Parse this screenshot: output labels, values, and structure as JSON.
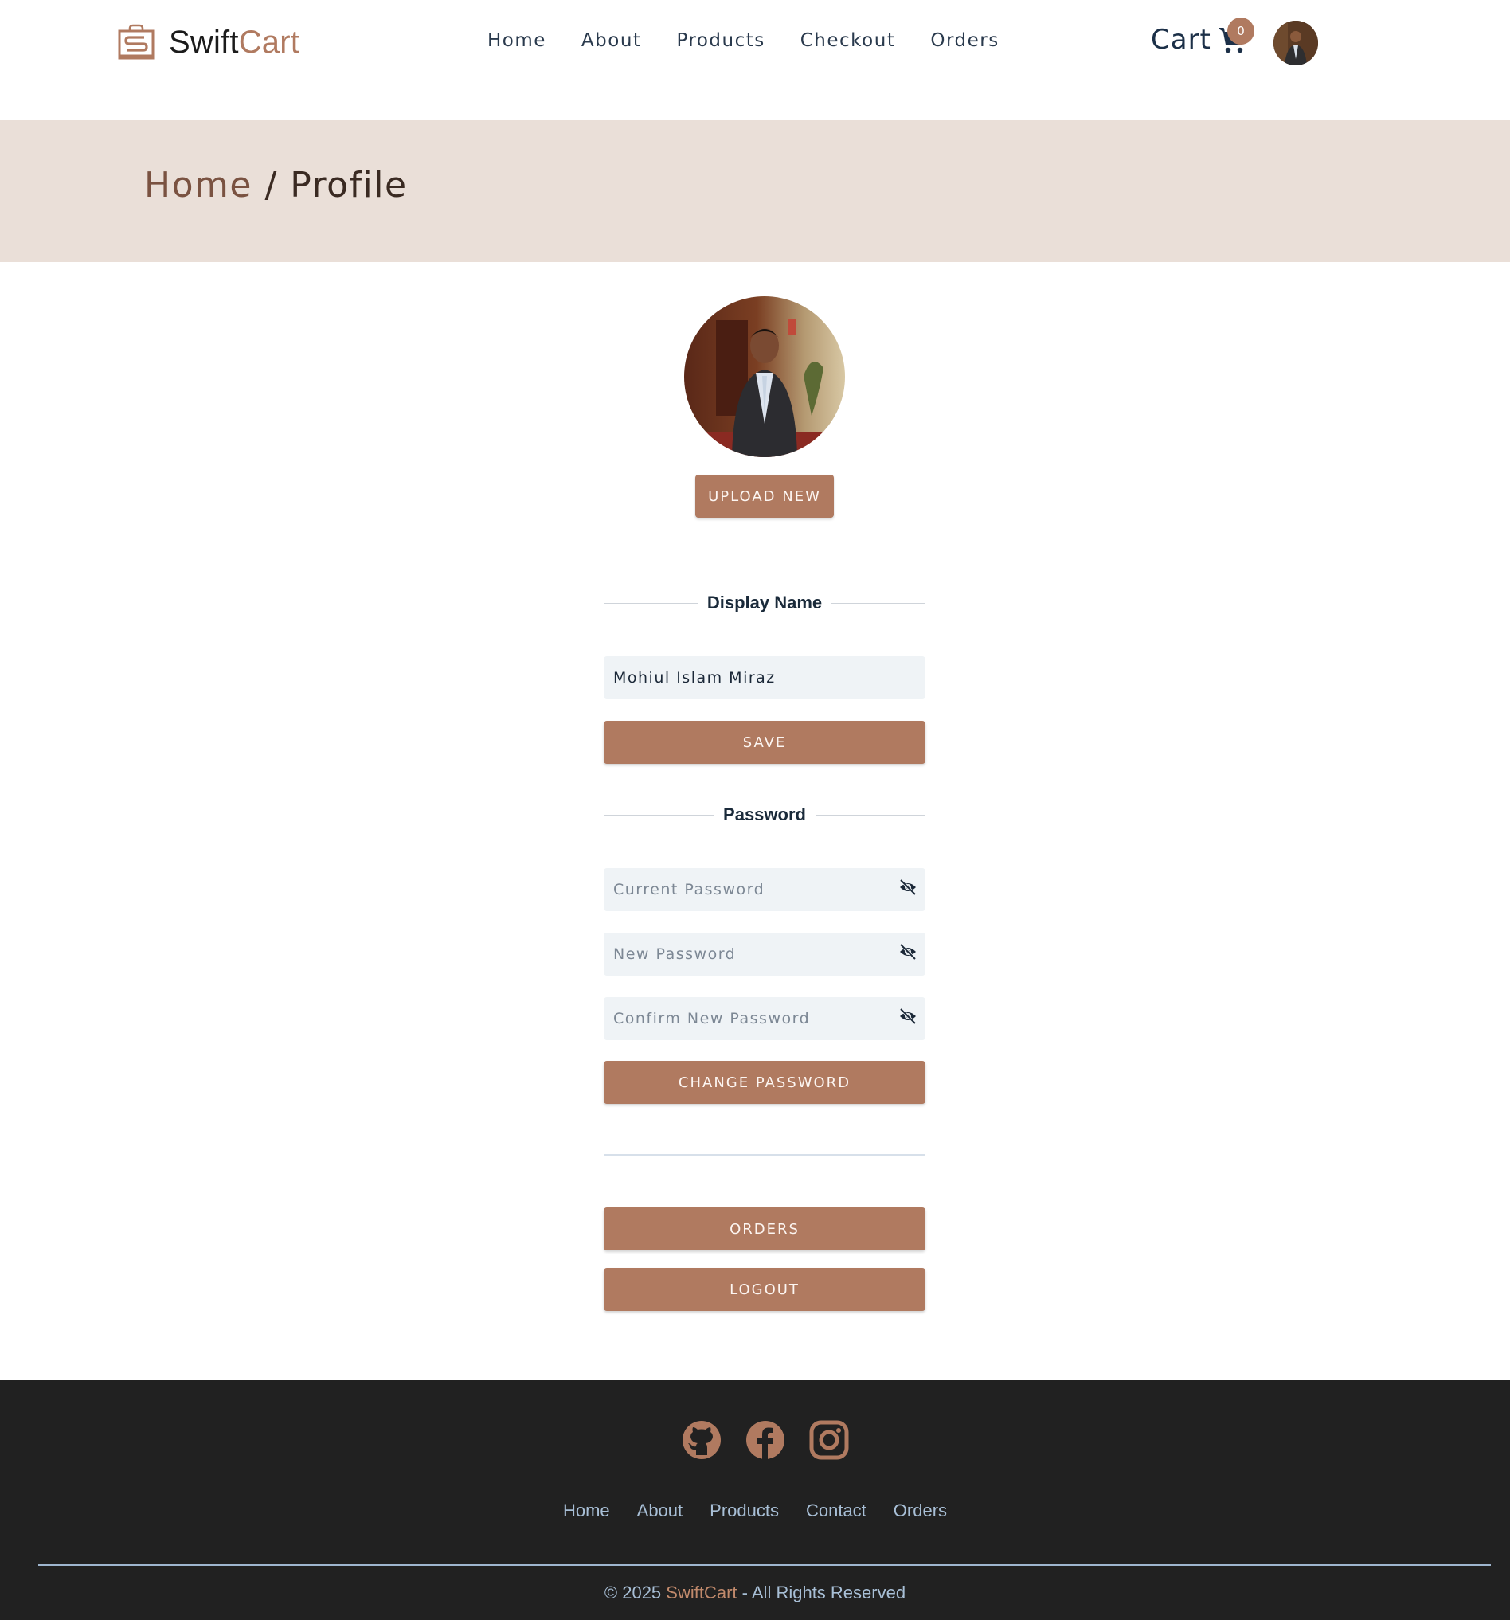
{
  "brand": {
    "name_part1": "Swift",
    "name_part2": "Cart",
    "icon": "shopping-bag-icon"
  },
  "nav": {
    "items": [
      "Home",
      "About",
      "Products",
      "Checkout",
      "Orders"
    ]
  },
  "cart": {
    "label": "Cart",
    "count": "0",
    "icon": "shopping-cart-icon"
  },
  "breadcrumb": {
    "home": "Home",
    "separator": "/",
    "current": "Profile"
  },
  "profile": {
    "upload_label": "UPLOAD NEW",
    "display_name_title": "Display Name",
    "display_name_value": "Mohiul Islam Miraz",
    "save_label": "SAVE",
    "password_title": "Password",
    "current_password_placeholder": "Current Password",
    "new_password_placeholder": "New Password",
    "confirm_password_placeholder": "Confirm New Password",
    "change_password_label": "CHANGE PASSWORD",
    "orders_label": "ORDERS",
    "logout_label": "LOGOUT"
  },
  "footer": {
    "social_icons": [
      "github-icon",
      "facebook-icon",
      "instagram-icon"
    ],
    "links": [
      "Home",
      "About",
      "Products",
      "Contact",
      "Orders"
    ],
    "copyright_prefix": "© 2025 ",
    "copyright_brand": "SwiftCart",
    "copyright_suffix": " - All Rights Reserved"
  },
  "colors": {
    "accent": "#b07a60",
    "band": "#eadfd8",
    "footer_bg": "#212121",
    "footer_text": "#a8bfd6"
  }
}
